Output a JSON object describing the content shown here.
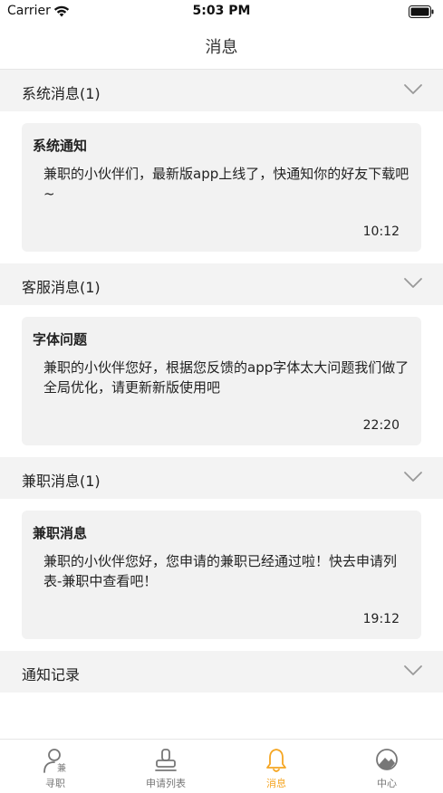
{
  "status_bar": {
    "carrier": "Carrier",
    "time": "5:03 PM"
  },
  "nav": {
    "title": "消息"
  },
  "sections": [
    {
      "title": "系统消息(1)",
      "card": {
        "title": "系统通知",
        "text": "兼职的小伙伴们，最新版app上线了，快通知你的好友下载吧~",
        "time": "10:12"
      }
    },
    {
      "title": "客服消息(1)",
      "card": {
        "title": "字体问题",
        "text": "兼职的小伙伴您好，根据您反馈的app字体太大问题我们做了全局优化，请更新新版使用吧",
        "time": "22:20"
      }
    },
    {
      "title": "兼职消息(1)",
      "card": {
        "title": "兼职消息",
        "text": "兼职的小伙伴您好，您申请的兼职已经通过啦！快去申请列表-兼职中查看吧！",
        "time": "19:12"
      }
    },
    {
      "title": "通知记录"
    }
  ],
  "tabs": [
    {
      "label": "寻职",
      "icon": "person-icon",
      "active": false
    },
    {
      "label": "申请列表",
      "icon": "stamp-icon",
      "active": false
    },
    {
      "label": "消息",
      "icon": "bell-icon",
      "active": true
    },
    {
      "label": "中心",
      "icon": "mountain-circle-icon",
      "active": false
    }
  ],
  "colors": {
    "accent": "#f5a623",
    "section_bg": "#f3f3f3",
    "card_bg": "#f2f2f2",
    "tab_inactive": "#777777"
  }
}
